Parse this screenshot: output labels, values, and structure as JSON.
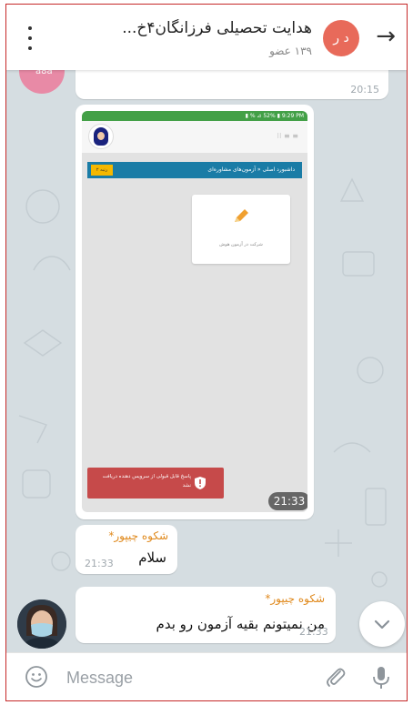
{
  "header": {
    "title": "هدایت تحصیلی فرزانگان۴خ...",
    "subtitle": "۱۳۹ عضو",
    "avatar_initials": "د ر",
    "avatar_color": "#e86a5a",
    "menu_icon": "more-vert-icon",
    "back_icon": "arrow-forward-icon"
  },
  "messages": [
    {
      "type": "text-fragment",
      "time": "20:15"
    },
    {
      "type": "photo",
      "time": "21:33",
      "screenshot": {
        "banner_text": "داشبورد اصلی « آزمون‌های مشاوره‌ای",
        "banner_tag": "۲ رتبه",
        "card_label": "شرکت در آزمون هوش",
        "toast_text": "پاسخ قابل قبولی از سرویس دهنده دریافت نشد"
      }
    },
    {
      "type": "text",
      "sender": "شکوه چیپور*",
      "text": "سلام",
      "time": "21:33"
    },
    {
      "type": "text",
      "sender": "شکوه چیپور*",
      "text": "من نمیتونم بقیه آزمون رو بدم",
      "time": "21:33"
    }
  ],
  "input": {
    "placeholder": "Message",
    "emoji_icon": "emoji-smile-icon",
    "attach_icon": "paperclip-icon",
    "mic_icon": "microphone-icon"
  },
  "colors": {
    "sender_name": "#e08a1e",
    "chat_background": "#d5dde1",
    "status_bar": "#43a047",
    "toast": "#c64a4a",
    "banner": "#1a7ca6"
  }
}
